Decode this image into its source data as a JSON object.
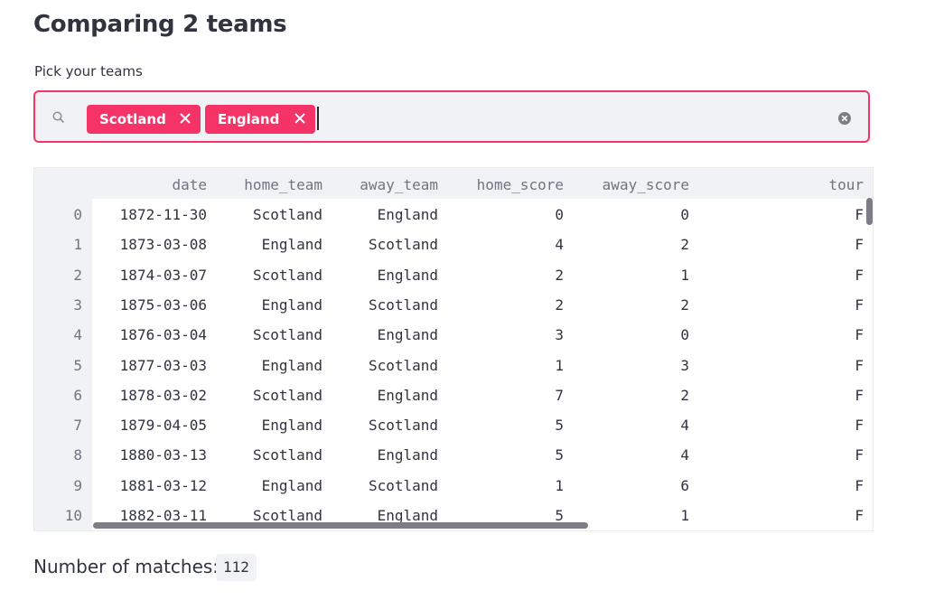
{
  "page": {
    "title": "Comparing 2 teams"
  },
  "team_picker": {
    "label": "Pick your teams",
    "selected": [
      "Scotland",
      "England"
    ],
    "accent_color": "#f63366",
    "icons": {
      "search": "search-icon",
      "remove": "close-icon",
      "clear": "clear-all-icon"
    }
  },
  "table": {
    "columns": [
      "date",
      "home_team",
      "away_team",
      "home_score",
      "away_score",
      "tour"
    ],
    "rows": [
      {
        "index": "0",
        "date": "1872-11-30",
        "home_team": "Scotland",
        "away_team": "England",
        "home_score": "0",
        "away_score": "0",
        "tournament": "F"
      },
      {
        "index": "1",
        "date": "1873-03-08",
        "home_team": "England",
        "away_team": "Scotland",
        "home_score": "4",
        "away_score": "2",
        "tournament": "F"
      },
      {
        "index": "2",
        "date": "1874-03-07",
        "home_team": "Scotland",
        "away_team": "England",
        "home_score": "2",
        "away_score": "1",
        "tournament": "F"
      },
      {
        "index": "3",
        "date": "1875-03-06",
        "home_team": "England",
        "away_team": "Scotland",
        "home_score": "2",
        "away_score": "2",
        "tournament": "F"
      },
      {
        "index": "4",
        "date": "1876-03-04",
        "home_team": "Scotland",
        "away_team": "England",
        "home_score": "3",
        "away_score": "0",
        "tournament": "F"
      },
      {
        "index": "5",
        "date": "1877-03-03",
        "home_team": "England",
        "away_team": "Scotland",
        "home_score": "1",
        "away_score": "3",
        "tournament": "F"
      },
      {
        "index": "6",
        "date": "1878-03-02",
        "home_team": "Scotland",
        "away_team": "England",
        "home_score": "7",
        "away_score": "2",
        "tournament": "F"
      },
      {
        "index": "7",
        "date": "1879-04-05",
        "home_team": "England",
        "away_team": "Scotland",
        "home_score": "5",
        "away_score": "4",
        "tournament": "F"
      },
      {
        "index": "8",
        "date": "1880-03-13",
        "home_team": "Scotland",
        "away_team": "England",
        "home_score": "5",
        "away_score": "4",
        "tournament": "F"
      },
      {
        "index": "9",
        "date": "1881-03-12",
        "home_team": "England",
        "away_team": "Scotland",
        "home_score": "1",
        "away_score": "6",
        "tournament": "F"
      },
      {
        "index": "10",
        "date": "1882-03-11",
        "home_team": "Scotland",
        "away_team": "England",
        "home_score": "5",
        "away_score": "1",
        "tournament": "F"
      }
    ]
  },
  "summary": {
    "label": "Number of matches:",
    "value": "112"
  }
}
